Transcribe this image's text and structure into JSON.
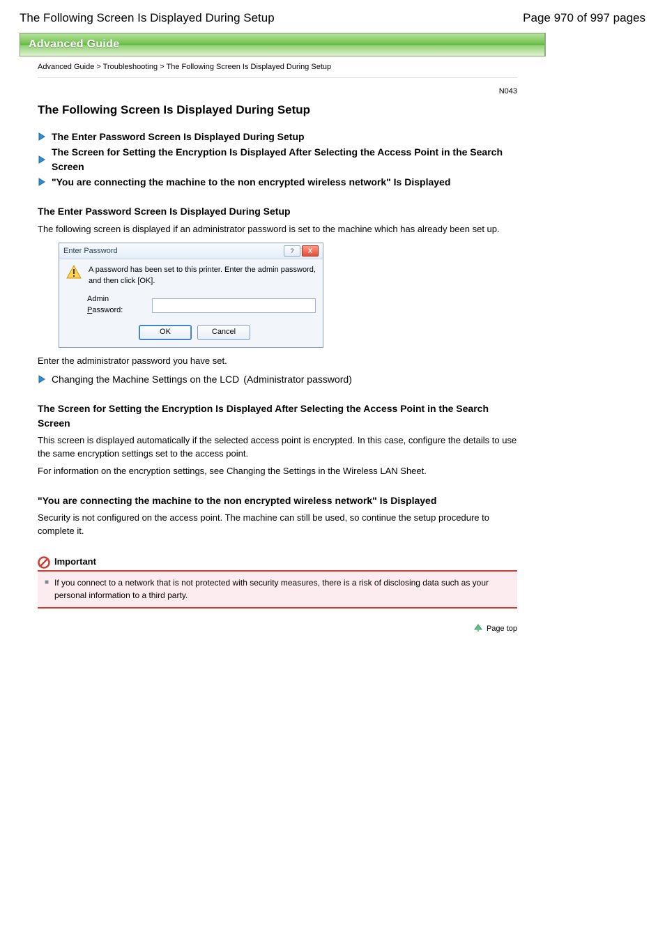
{
  "header": {
    "left": "The Following Screen Is Displayed During Setup",
    "right": "Page 970 of 997 pages"
  },
  "banner": "Advanced Guide",
  "breadcrumb": "Advanced Guide > Troubleshooting > The Following Screen Is Displayed During Setup",
  "doc_id": "N043",
  "title": "The Following Screen Is Displayed During Setup",
  "sections": [
    {
      "heading": "The Enter Password Screen Is Displayed During Setup",
      "paras": []
    },
    {
      "heading": "The Screen for Setting the Encryption Is Displayed After Selecting the Access Point in the Search Screen",
      "paras": []
    },
    {
      "heading": "\"You are connecting the machine to the non encrypted wireless network\" Is Displayed",
      "paras": []
    }
  ],
  "section_pwd": {
    "heading": "The Enter Password Screen Is Displayed During Setup",
    "lead": "The following screen is displayed if an administrator password is set to the machine which has already been set up."
  },
  "dialog": {
    "title": "Enter Password",
    "help": "?",
    "close": "X",
    "message": "A password has been set to this printer. Enter the admin password, and then click [OK].",
    "label_pre": "Admin ",
    "label_u": "P",
    "label_post": "assword:",
    "ok": "OK",
    "cancel": "Cancel",
    "value": ""
  },
  "after_dialog": {
    "para1": "Enter the administrator password you have set.",
    "link": "Changing the Machine Settings on the LCD",
    "para2": "(Administrator password)"
  },
  "section_enc": {
    "heading": "The Screen for Setting the Encryption Is Displayed After Selecting the Access Point in the Search Screen",
    "para": "This screen is displayed automatically if the selected access point is encrypted. In this case, configure the details to use the same encryption settings set to the access point.",
    "para2": "For information on the encryption settings, see Changing the Settings in the Wireless LAN Sheet."
  },
  "section_warn": {
    "heading": "\"You are connecting the machine to the non encrypted wireless network\" Is Displayed",
    "para": "Security is not configured on the access point. The machine can still be used, so continue the setup procedure to complete it."
  },
  "important": {
    "label": "Important",
    "body": "If you connect to a network that is not protected with security measures, there is a risk of disclosing data such as your personal information to a third party."
  },
  "page_top": "Page top"
}
